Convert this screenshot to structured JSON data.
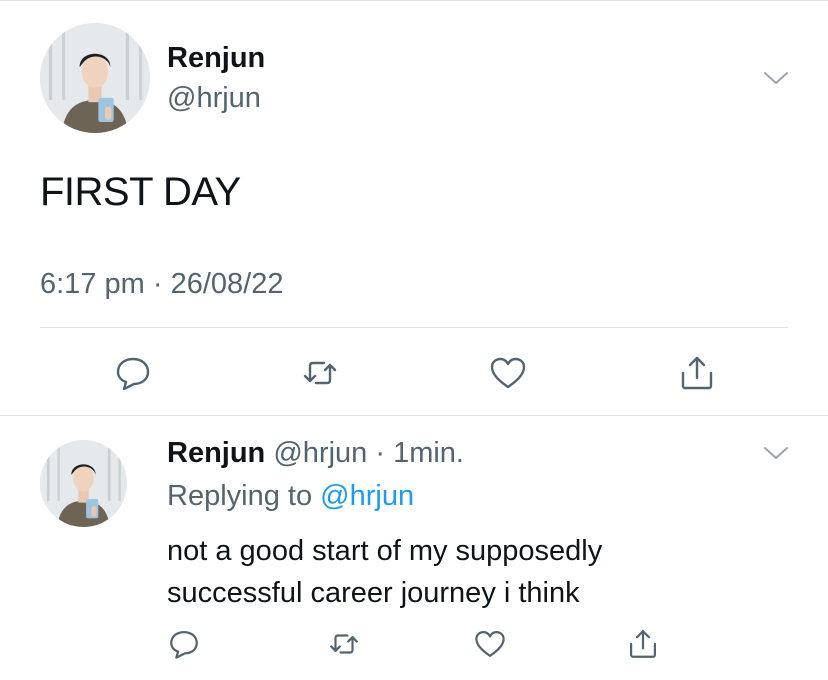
{
  "tweet": {
    "author_name": "Renjun",
    "author_handle": "@hrjun",
    "text": "FIRST DAY",
    "time": "6:17 pm",
    "separator": " · ",
    "date": "26/08/22"
  },
  "reply": {
    "author_name": "Renjun",
    "author_handle": "@hrjun",
    "time_sep": " · ",
    "age": "1min.",
    "replying_label": "Replying to ",
    "replying_to": "@hrjun",
    "text_line1": "not a good start of my supposedly",
    "text_line2": "successful career journey i think"
  },
  "icons": {
    "reply": "reply-icon",
    "retweet": "retweet-icon",
    "like": "heart-icon",
    "share": "share-icon",
    "more": "chevron-down-icon"
  },
  "colors": {
    "text": "#0f1419",
    "secondary": "#536471",
    "link": "#1d9bf0",
    "divider": "#e1e4e6"
  }
}
